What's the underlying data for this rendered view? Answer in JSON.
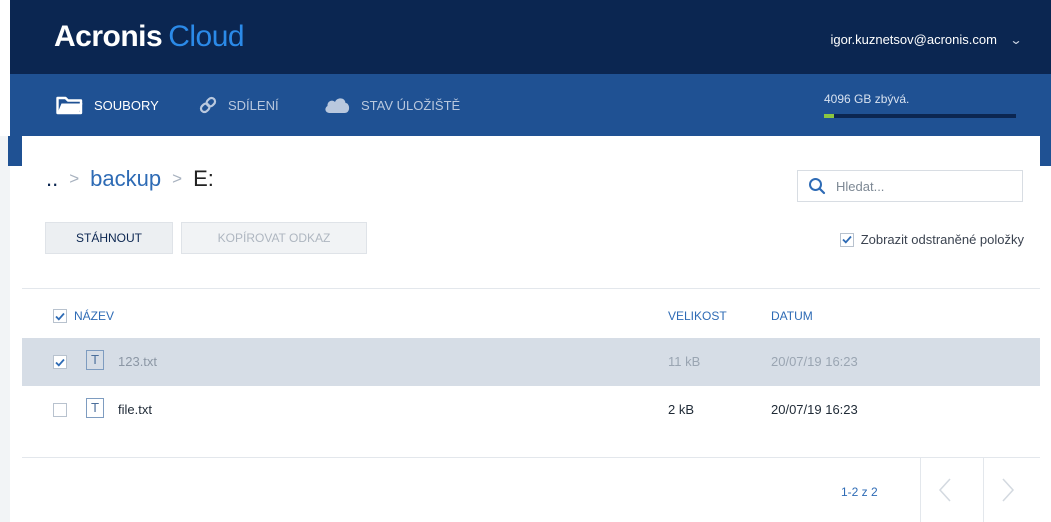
{
  "app": {
    "brand_bold": "Acronis",
    "brand_light": "Cloud",
    "user_email": "igor.kuznetsov@acronis.com"
  },
  "nav": {
    "items": [
      {
        "label": "SOUBORY",
        "icon": "folder-icon",
        "active": true
      },
      {
        "label": "SDÍLENÍ",
        "icon": "link-icon",
        "active": false
      },
      {
        "label": "STAV ÚLOŽIŠTĚ",
        "icon": "cloud-icon",
        "active": false
      }
    ],
    "storage_text": "4096 GB zbývá.",
    "storage_used_fraction": 0.05
  },
  "breadcrumb": {
    "items": [
      "..",
      "backup",
      "E:"
    ]
  },
  "search": {
    "placeholder": "Hledat..."
  },
  "toolbar": {
    "download_label": "STÁHNOUT",
    "copy_link_label": "KOPÍROVAT ODKAZ",
    "show_deleted_label": "Zobrazit odstraněné položky",
    "show_deleted_checked": true
  },
  "table": {
    "columns": [
      "NÁZEV",
      "VELIKOST",
      "DATUM"
    ],
    "header_checked": true,
    "rows": [
      {
        "name": "123.txt",
        "icon": "T",
        "size": "11 kB",
        "date": "20/07/19 16:23",
        "selected": true
      },
      {
        "name": "file.txt",
        "icon": "T",
        "size": "2 kB",
        "date": "20/07/19 16:23",
        "selected": false
      }
    ]
  },
  "pagination": {
    "text": "1-2 z 2"
  },
  "colors": {
    "header_dark": "#0b2651",
    "nav_blue": "#1f5193",
    "accent": "#2e6bb5",
    "storage_green": "#8bc740",
    "selected_row": "#d6dde6"
  }
}
